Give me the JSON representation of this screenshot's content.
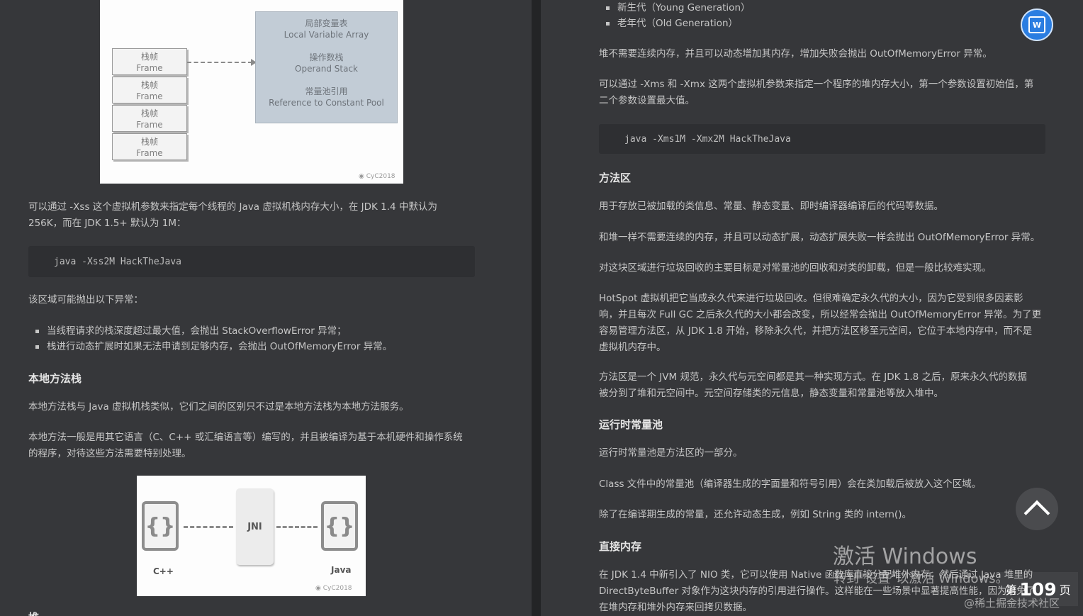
{
  "left": {
    "fig1": {
      "frame_cn": "栈帧",
      "frame_en": "Frame",
      "lva_cn": "局部变量表",
      "lva_en": "Local Variable Array",
      "os_cn": "操作数栈",
      "os_en": "Operand Stack",
      "rcp_cn": "常量池引用",
      "rcp_en": "Reference to Constant Pool",
      "credit": "CyC2018"
    },
    "p1_line1": "可以通过 -Xss 这个虚拟机参数来指定每个线程的 Java 虚拟机栈内存大小，在 JDK 1.4 中默认为",
    "p1_line2": "256K，而在 JDK 1.5+ 默认为 1M：",
    "code1": "java -Xss2M HackTheJava",
    "p2": "该区域可能抛出以下异常：",
    "bullets": [
      "当线程请求的栈深度超过最大值，会抛出 StackOverflowError 异常；",
      "栈进行动态扩展时如果无法申请到足够内存，会抛出 OutOfMemoryError 异常。"
    ],
    "h_native": "本地方法栈",
    "p3": "本地方法栈与 Java 虚拟机栈类似，它们之间的区别只不过是本地方法栈为本地方法服务。",
    "p4_line1": "本地方法一般是用其它语言（C、C++ 或汇编语言等）编写的，并且被编译为基于本机硬件和操作系统",
    "p4_line2": "的程序，对待这些方法需要特别处理。",
    "fig2": {
      "left_label": "C++",
      "mid_label": "JNI",
      "right_label": "Java",
      "brace": "{}",
      "credit": "CyC2018"
    },
    "cut_heading": "堆"
  },
  "right": {
    "bullets": [
      "新生代（Young Generation）",
      "老年代（Old Generation）"
    ],
    "p1": "堆不需要连续内存，并且可以动态增加其内存，增加失败会抛出 OutOfMemoryError 异常。",
    "p2_line1": "可以通过 -Xms 和 -Xmx 这两个虚拟机参数来指定一个程序的堆内存大小，第一个参数设置初始值，第",
    "p2_line2": "二个参数设置最大值。",
    "code1": "java -Xms1M -Xmx2M HackTheJava",
    "h_method": "方法区",
    "p3": "用于存放已被加载的类信息、常量、静态变量、即时编译器编译后的代码等数据。",
    "p4": "和堆一样不需要连续的内存，并且可以动态扩展，动态扩展失败一样会抛出 OutOfMemoryError 异常。",
    "p5": "对这块区域进行垃圾回收的主要目标是对常量池的回收和对类的卸载，但是一般比较难实现。",
    "p6_line1": "HotSpot 虚拟机把它当成永久代来进行垃圾回收。但很难确定永久代的大小，因为它受到很多因素影",
    "p6_line2": "响，并且每次 Full GC 之后永久代的大小都会改变，所以经常会抛出 OutOfMemoryError 异常。为了更",
    "p6_line3": "容易管理方法区，从 JDK 1.8 开始，移除永久代，并把方法区移至元空间，它位于本地内存中，而不是",
    "p6_line4": "虚拟机内存中。",
    "p7_line1": "方法区是一个 JVM 规范，永久代与元空间都是其一种实现方式。在 JDK 1.8 之后，原来永久代的数据",
    "p7_line2": "被分到了堆和元空间中。元空间存储类的元信息，静态变量和常量池等放入堆中。",
    "h_runtime": "运行时常量池",
    "p8": "运行时常量池是方法区的一部分。",
    "p9": "Class 文件中的常量池（编译器生成的字面量和符号引用）会在类加载后被放入这个区域。",
    "p10": "除了在编译期生成的常量，还允许动态生成，例如 String 类的 intern()。",
    "h_direct": "直接内存",
    "p11_line1": "在 JDK 1.4 中新引入了 NIO 类，它可以使用 Native 函数库直接分配堆外内存，然后通过 Java 堆里的",
    "p11_line2": "DirectByteBuffer 对象作为这块内存的引用进行操作。这样能在一些场景中显著提高性能，因为避免了",
    "p11_line3": "在堆内存和堆外内存来回拷贝数据。"
  },
  "overlay": {
    "fab_letter": "W",
    "activation_title": "激活 Windows",
    "activation_sub": "转到\"设置\"以激活 Windows。",
    "page_prefix": "第",
    "page_number": "109",
    "page_suffix": "页",
    "site_watermark": "@稀土掘金技术社区"
  }
}
